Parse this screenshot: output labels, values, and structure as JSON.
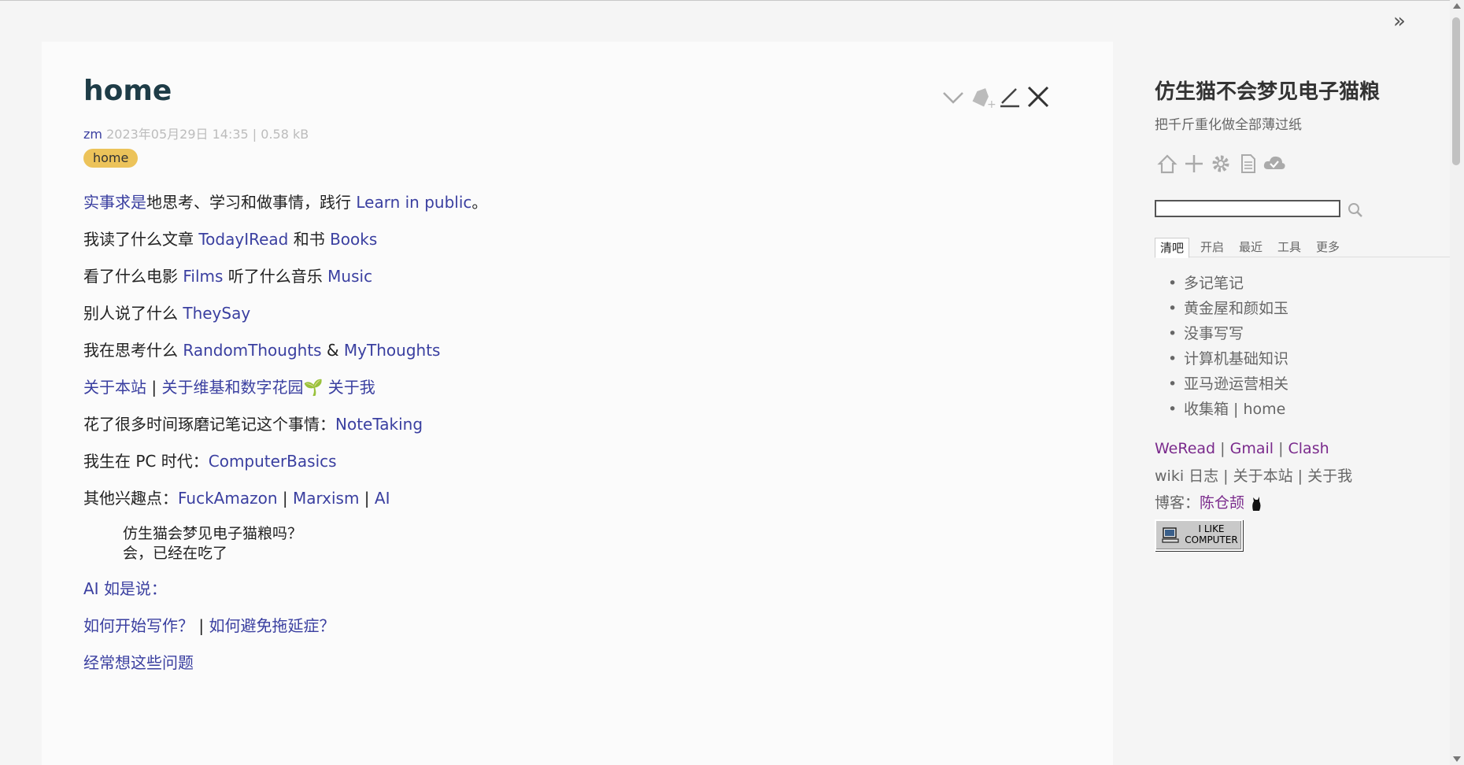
{
  "tiddler": {
    "title": "home",
    "author": "zm",
    "meta": "2023年05月29日 14:35 | 0.58 kB",
    "tag": "home"
  },
  "body": {
    "p1": {
      "link1": "实事求是",
      "text1": "地思考、学习和做事情，践行 ",
      "link2": "Learn in public",
      "text2": "。"
    },
    "p2": {
      "text1": "我读了什么文章 ",
      "link1": "TodayIRead",
      "text2": " 和书 ",
      "link2": "Books"
    },
    "p3": {
      "text1": "看了什么电影 ",
      "link1": "Films",
      "text2": " 听了什么音乐 ",
      "link2": "Music"
    },
    "p4": {
      "text1": "别人说了什么 ",
      "link1": "TheySay"
    },
    "p5": {
      "text1": "我在思考什么 ",
      "link1": "RandomThoughts",
      "text2": " & ",
      "link2": "MyThoughts"
    },
    "p6": {
      "link1": "关于本站",
      "sep1": " | ",
      "link2": "关于维基和数字花园",
      "emoji": "🌱",
      "link3": " 关于我"
    },
    "p7": {
      "text1": "花了很多时间琢磨记笔记这个事情：",
      "link1": "NoteTaking"
    },
    "p8": {
      "text1": "我生在 PC 时代：",
      "link1": "ComputerBasics"
    },
    "p9": {
      "text1": "其他兴趣点：",
      "link1": "FuckAmazon",
      "sep1": " | ",
      "link2": "Marxism",
      "sep2": " | ",
      "link3": "AI"
    },
    "quote1": "仿生猫会梦见电子猫粮吗？",
    "quote2": "会，已经在吃了",
    "p10": {
      "link1": "AI 如是说："
    },
    "p11": {
      "link1": "如何开始写作？",
      "sep1": " | ",
      "link2": "如何避免拖延症？"
    },
    "p12": {
      "link1": "经常想这些问题"
    }
  },
  "toolbar": {
    "icons": [
      "chevron-down-icon",
      "tag-add-icon",
      "edit-icon",
      "close-icon"
    ]
  },
  "sidebar": {
    "site_title": "仿生猫不会梦见电子猫粮",
    "site_subtitle": "把千斤重化做全部薄过纸",
    "controls": [
      "home-icon",
      "new-tiddler-icon",
      "settings-icon",
      "document-icon",
      "cloud-save-icon"
    ],
    "search_value": "",
    "tabs": [
      "清吧",
      "开启",
      "最近",
      "工具",
      "更多"
    ],
    "active_tab": "清吧",
    "nav": [
      "多记笔记",
      "黄金屋和颜如玉",
      "没事写写",
      "计算机基础知识",
      "亚马逊运营相关",
      "收集箱 | home"
    ],
    "links_row1": {
      "a": "WeRead",
      "s1": " | ",
      "b": "Gmail",
      "s2": " | ",
      "c": "Clash"
    },
    "links_row2": "wiki 日志 | 关于本站 | 关于我",
    "links_row3": {
      "label": "博客：",
      "link": "陈仓颉"
    },
    "badge": {
      "line1": "I LIKE",
      "line2": "COMPUTER"
    }
  },
  "colors": {
    "link": "#3a3fa0",
    "visited": "#7a2a8c",
    "tag": "#ecc35a",
    "title": "#1e3c47"
  }
}
